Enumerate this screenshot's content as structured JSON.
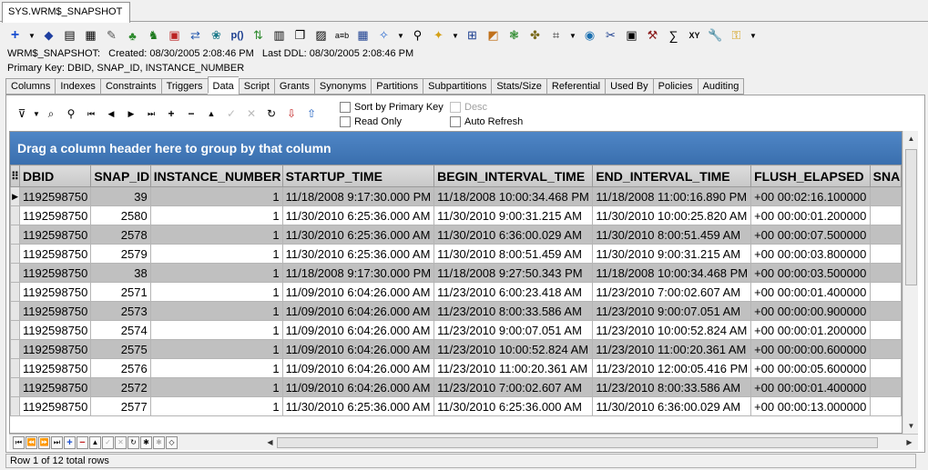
{
  "doc_tab": "SYS.WRM$_SNAPSHOT",
  "toolbar": {
    "icons": [
      "add-icon",
      "dropdown-arrow-icon",
      "edit-icon",
      "script-icon",
      "calculator-icon",
      "rename-icon",
      "grant-icon",
      "compile-icon",
      "export-icon",
      "import-icon",
      "compare-icon",
      "procedure-icon",
      "recompile-icon",
      "report-icon",
      "copy-icon",
      "text-icon",
      "grid-icon",
      "new-object-icon",
      "find-icon",
      "bulb-icon",
      "tree-icon",
      "chart-icon",
      "stats-icon",
      "describe-icon",
      "sql-icon",
      "database-icon",
      "query-icon",
      "browser-icon",
      "tools-icon",
      "sum-icon",
      "xy-icon",
      "wrench-icon",
      "key-icon"
    ],
    "p_label": "p()",
    "ab_label": "a≡b",
    "sigma_label": "∑",
    "xy_label": "XY"
  },
  "info": {
    "name": "WRM$_SNAPSHOT:",
    "created": "Created: 08/30/2005 2:08:46 PM",
    "last_ddl": "Last DDL: 08/30/2005 2:08:46 PM",
    "primary_key": "Primary Key:  DBID, SNAP_ID, INSTANCE_NUMBER"
  },
  "tabs": [
    "Columns",
    "Indexes",
    "Constraints",
    "Triggers",
    "Data",
    "Script",
    "Grants",
    "Synonyms",
    "Partitions",
    "Subpartitions",
    "Stats/Size",
    "Referential",
    "Used By",
    "Policies",
    "Auditing"
  ],
  "active_tab": "Data",
  "options": {
    "sort_pk": "Sort by Primary Key",
    "read_only": "Read Only",
    "desc": "Desc",
    "auto_refresh": "Auto Refresh"
  },
  "group_bar": "Drag a column header here to group by that column",
  "columns": [
    "DBID",
    "SNAP_ID",
    "INSTANCE_NUMBER",
    "STARTUP_TIME",
    "BEGIN_INTERVAL_TIME",
    "END_INTERVAL_TIME",
    "FLUSH_ELAPSED",
    "SNA"
  ],
  "rows": [
    [
      "1192598750",
      "39",
      "1",
      "11/18/2008 9:17:30.000 PM",
      "11/18/2008 10:00:34.468 PM",
      "11/18/2008 11:00:16.890 PM",
      "+00 00:02:16.100000",
      ""
    ],
    [
      "1192598750",
      "2580",
      "1",
      "11/30/2010 6:25:36.000 AM",
      "11/30/2010 9:00:31.215 AM",
      "11/30/2010 10:00:25.820 AM",
      "+00 00:00:01.200000",
      ""
    ],
    [
      "1192598750",
      "2578",
      "1",
      "11/30/2010 6:25:36.000 AM",
      "11/30/2010 6:36:00.029 AM",
      "11/30/2010 8:00:51.459 AM",
      "+00 00:00:07.500000",
      ""
    ],
    [
      "1192598750",
      "2579",
      "1",
      "11/30/2010 6:25:36.000 AM",
      "11/30/2010 8:00:51.459 AM",
      "11/30/2010 9:00:31.215 AM",
      "+00 00:00:03.800000",
      ""
    ],
    [
      "1192598750",
      "38",
      "1",
      "11/18/2008 9:17:30.000 PM",
      "11/18/2008 9:27:50.343 PM",
      "11/18/2008 10:00:34.468 PM",
      "+00 00:00:03.500000",
      ""
    ],
    [
      "1192598750",
      "2571",
      "1",
      "11/09/2010 6:04:26.000 AM",
      "11/23/2010 6:00:23.418 AM",
      "11/23/2010 7:00:02.607 AM",
      "+00 00:00:01.400000",
      ""
    ],
    [
      "1192598750",
      "2573",
      "1",
      "11/09/2010 6:04:26.000 AM",
      "11/23/2010 8:00:33.586 AM",
      "11/23/2010 9:00:07.051 AM",
      "+00 00:00:00.900000",
      ""
    ],
    [
      "1192598750",
      "2574",
      "1",
      "11/09/2010 6:04:26.000 AM",
      "11/23/2010 9:00:07.051 AM",
      "11/23/2010 10:00:52.824 AM",
      "+00 00:00:01.200000",
      ""
    ],
    [
      "1192598750",
      "2575",
      "1",
      "11/09/2010 6:04:26.000 AM",
      "11/23/2010 10:00:52.824 AM",
      "11/23/2010 11:00:20.361 AM",
      "+00 00:00:00.600000",
      ""
    ],
    [
      "1192598750",
      "2576",
      "1",
      "11/09/2010 6:04:26.000 AM",
      "11/23/2010 11:00:20.361 AM",
      "11/23/2010 12:00:05.416 PM",
      "+00 00:00:05.600000",
      ""
    ],
    [
      "1192598750",
      "2572",
      "1",
      "11/09/2010 6:04:26.000 AM",
      "11/23/2010 7:00:02.607 AM",
      "11/23/2010 8:00:33.586 AM",
      "+00 00:00:01.400000",
      ""
    ],
    [
      "1192598750",
      "2577",
      "1",
      "11/30/2010 6:25:36.000 AM",
      "11/30/2010 6:25:36.000 AM",
      "11/30/2010 6:36:00.029 AM",
      "+00 00:00:13.000000",
      ""
    ]
  ],
  "status": "Row 1 of 12 total rows"
}
